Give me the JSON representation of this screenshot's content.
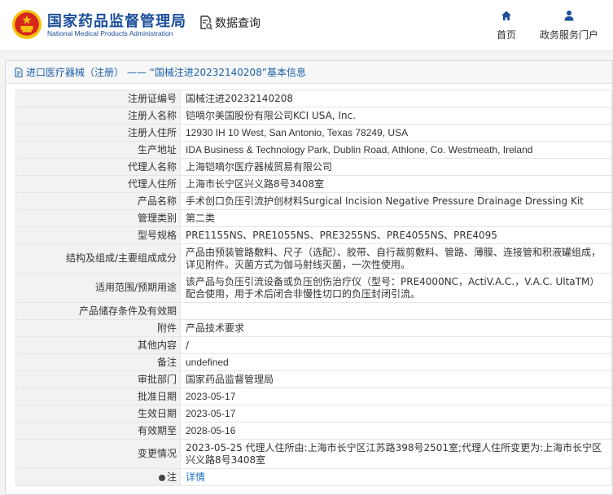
{
  "header": {
    "logo_cn": "国家药品监督管理局",
    "logo_en": "National Medical Products Administration",
    "query_label": "数据查询",
    "nav_home": "首页",
    "nav_portal": "政务服务门户",
    "emblem_icon": "national-emblem-icon",
    "query_icon": "document-search-icon",
    "home_icon": "home-icon",
    "user_icon": "user-icon"
  },
  "panel": {
    "title": "进口医疗器械（注册） —— “国械注进20232140208”基本信息",
    "title_icon": "document-icon"
  },
  "rows": [
    {
      "label": "注册证编号",
      "value": "国械注进20232140208"
    },
    {
      "label": "注册人名称",
      "value": "铠嘀尔美国股份有限公司KCI USA, Inc."
    },
    {
      "label": "注册人住所",
      "value": "12930 IH 10 West, San Antonio, Texas 78249, USA"
    },
    {
      "label": "生产地址",
      "value": "IDA Business & Technology Park, Dublin Road, Athlone, Co. Westmeath, Ireland"
    },
    {
      "label": "代理人名称",
      "value": "上海铠嘀尔医疗器械贸易有限公司"
    },
    {
      "label": "代理人住所",
      "value": "上海市长宁区兴义路8号3408室"
    },
    {
      "label": "产品名称",
      "value": "手术创口负压引流护创材料Surgical Incision Negative Pressure Drainage Dressing Kit"
    },
    {
      "label": "管理类别",
      "value": "第二类"
    },
    {
      "label": "型号规格",
      "value": "PRE1155NS、PRE1055NS、PRE3255NS、PRE4055NS、PRE4095"
    },
    {
      "label": "结构及组成/主要组成成分",
      "value": "产品由预装管路敷料、尺子（选配）、胶带、自行裁剪敷料、管路、薄膜、连接管和积液罐组成，详见附件。灭菌方式为伽马射线灭菌，一次性使用。"
    },
    {
      "label": "适用范围/预期用途",
      "value": "该产品与负压引流设备或负压创伤治疗仪（型号：PRE4000NC，ActiV.A.C.，V.A.C. UltaTM）配合使用，用于术后闭合非慢性切口的负压封闭引流。"
    },
    {
      "label": "产品储存条件及有效期",
      "value": ""
    },
    {
      "label": "附件",
      "value": "产品技术要求"
    },
    {
      "label": "其他内容",
      "value": "/"
    },
    {
      "label": "备注",
      "value": "undefined"
    },
    {
      "label": "审批部门",
      "value": "国家药品监督管理局"
    },
    {
      "label": "批准日期",
      "value": "2023-05-17"
    },
    {
      "label": "生效日期",
      "value": "2023-05-17"
    },
    {
      "label": "有效期至",
      "value": "2028-05-16"
    },
    {
      "label": "变更情况",
      "value": "2023-05-25 代理人住所由:上海市长宁区江苏路398号2501室;代理人住所变更为:上海市长宁区兴义路8号3408室"
    },
    {
      "label": "注",
      "value": "详情"
    }
  ],
  "colors": {
    "brand_blue": "#1c4f9c",
    "title_blue": "#1a5fa8",
    "link_blue": "#1a6fc2",
    "label_bg": "#f2f2f2",
    "emblem_red": "#d7261e",
    "emblem_gold": "#f4c20d"
  }
}
